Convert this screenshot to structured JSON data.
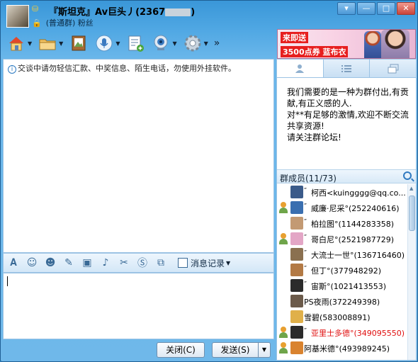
{
  "window": {
    "title_name": "『斯坦克』Av巨头丿(2367",
    "title_suffix": ")",
    "group_type": "(普通群)",
    "group_sub": "粉丝",
    "buttons": {
      "min_tray": "▾",
      "minimize": "—",
      "maximize": "□",
      "close": "✕"
    }
  },
  "banner": {
    "line1": "来即送",
    "line2": "3500点券 蓝布衣"
  },
  "toolbar": {
    "items": [
      {
        "name": "group-home-icon"
      },
      {
        "name": "folder-share-icon"
      },
      {
        "name": "album-icon"
      },
      {
        "name": "voice-chat-icon"
      },
      {
        "name": "group-app-icon"
      },
      {
        "name": "video-icon"
      },
      {
        "name": "settings-icon"
      }
    ],
    "more": "»"
  },
  "chat": {
    "warning": "交谈中请勿轻信汇款、中奖信息、陌生电话，勿使用外挂软件。"
  },
  "format_bar": {
    "history_label": "消息记录"
  },
  "buttons": {
    "close_label": "关闭(C)",
    "send_label": "发送(S)",
    "send_arrow": "▼"
  },
  "right_panel": {
    "announcement": "我们需要的是一种为群付出,有贡献,有正义感的人.\n对**有足够的激情,欢迎不断交流共享资源!\n请关注群论坛!",
    "members_title": "群成员(11/73)",
    "members": [
      {
        "name": "柯西<kuingggg@qq.co...",
        "quote": "″",
        "has_role": false,
        "avatar_color": "#3b5b8a",
        "highlight": false
      },
      {
        "name": "威廉·尼采°(252240616)",
        "quote": "″",
        "has_role": true,
        "avatar_color": "#3a6fb0",
        "highlight": false
      },
      {
        "name": "柏拉图°(1144283358)",
        "quote": "″",
        "has_role": false,
        "avatar_color": "#c39a73",
        "highlight": false
      },
      {
        "name": "哥白尼°(2521987729)",
        "quote": "″",
        "has_role": true,
        "avatar_color": "#e3a6c6",
        "highlight": false
      },
      {
        "name": "大流士一世°(136716460)",
        "quote": "″",
        "has_role": false,
        "avatar_color": "#8a7050",
        "highlight": false
      },
      {
        "name": "但丁°(377948292)",
        "quote": "″",
        "has_role": false,
        "avatar_color": "#b37a45",
        "highlight": false
      },
      {
        "name": "宙斯°(1021413553)",
        "quote": "″",
        "has_role": false,
        "avatar_color": "#2b2b2b",
        "highlight": false
      },
      {
        "name": "PS夜雨(372249398)",
        "quote": "",
        "has_role": false,
        "avatar_color": "#6b5a4a",
        "highlight": false
      },
      {
        "name": "雪碧(583008891)",
        "quote": "",
        "has_role": false,
        "avatar_color": "#e0b04a",
        "highlight": false
      },
      {
        "name": "亚里士多德°(349095550)",
        "quote": "″",
        "has_role": true,
        "avatar_color": "#2b2b2b",
        "highlight": true
      },
      {
        "name": "阿基米德°(493989245)",
        "quote": "",
        "has_role": true,
        "avatar_color": "#d9832f",
        "highlight": false
      }
    ]
  }
}
